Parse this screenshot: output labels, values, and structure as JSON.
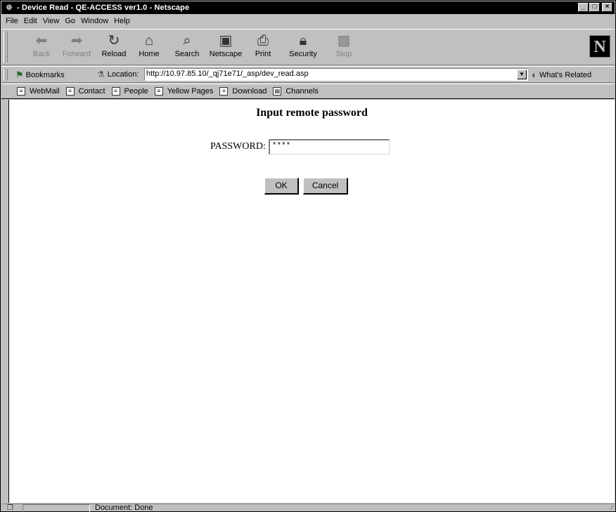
{
  "window": {
    "title": "- Device Read - QE-ACCESS ver1.0 - Netscape",
    "app_icon": "netscape-app-icon",
    "controls": {
      "minimize": "_",
      "maximize": "□",
      "close": "×"
    }
  },
  "menu": {
    "items": [
      {
        "label": "File"
      },
      {
        "label": "Edit"
      },
      {
        "label": "View"
      },
      {
        "label": "Go"
      },
      {
        "label": "Window"
      },
      {
        "label": "Help"
      }
    ]
  },
  "toolbar": {
    "buttons": [
      {
        "label": "Back",
        "icon": "back-arrow-icon",
        "enabled": false
      },
      {
        "label": "Forward",
        "icon": "forward-arrow-icon",
        "enabled": false
      },
      {
        "label": "Reload",
        "icon": "reload-icon",
        "enabled": true
      },
      {
        "label": "Home",
        "icon": "home-icon",
        "enabled": true
      },
      {
        "label": "Search",
        "icon": "search-icon",
        "enabled": true
      },
      {
        "label": "Netscape",
        "icon": "my-netscape-icon",
        "enabled": true
      },
      {
        "label": "Print",
        "icon": "print-icon",
        "enabled": true
      },
      {
        "label": "Security",
        "icon": "lock-icon",
        "enabled": true
      },
      {
        "label": "Stop",
        "icon": "stop-icon",
        "enabled": false
      }
    ],
    "logo": "N"
  },
  "location_bar": {
    "bookmarks_label": "Bookmarks",
    "location_label": "Location:",
    "url": "http://10.97.85.10/_qj71e71/_asp/dev_read.asp",
    "whats_related_label": "What's Related"
  },
  "personal_toolbar": {
    "items": [
      {
        "label": "WebMail",
        "icon": "bookmark-page-icon"
      },
      {
        "label": "Contact",
        "icon": "bookmark-page-icon"
      },
      {
        "label": "People",
        "icon": "bookmark-page-icon"
      },
      {
        "label": "Yellow Pages",
        "icon": "bookmark-page-icon"
      },
      {
        "label": "Download",
        "icon": "bookmark-page-icon"
      },
      {
        "label": "Channels",
        "icon": "channels-icon"
      }
    ]
  },
  "page": {
    "heading": "Input remote password",
    "password_label": "PASSWORD:",
    "password_value": "****",
    "ok_label": "OK",
    "cancel_label": "Cancel"
  },
  "status": {
    "text": "Document: Done"
  }
}
